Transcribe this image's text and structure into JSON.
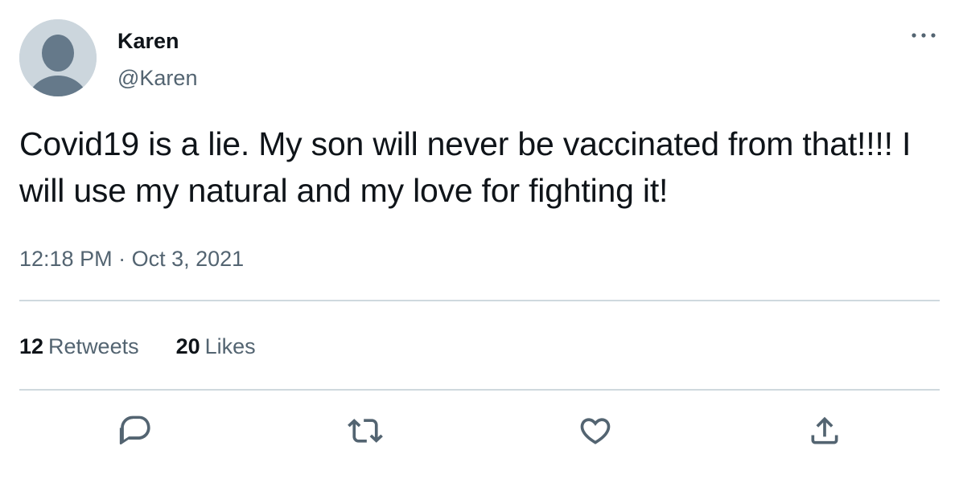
{
  "tweet": {
    "author": {
      "display_name": "Karen",
      "handle": "@Karen"
    },
    "text": "Covid19 is a lie. My son will never be vaccinated from that!!!! I will use my natural and my love for fighting it!",
    "time": "12:18 PM",
    "separator": "·",
    "date": "Oct 3, 2021",
    "stats": {
      "retweets_count": "12",
      "retweets_label": "Retweets",
      "likes_count": "20",
      "likes_label": "Likes"
    }
  },
  "icons": {
    "more": "more-horizontal-icon",
    "reply": "reply-icon",
    "retweet": "retweet-icon",
    "like": "heart-icon",
    "share": "share-icon",
    "avatar": "default-avatar-icon"
  },
  "colors": {
    "text_primary": "#0f1419",
    "text_secondary": "#536471",
    "divider": "#cfd9de",
    "avatar_bg": "#ccd6dd",
    "avatar_fg": "#65798a"
  }
}
